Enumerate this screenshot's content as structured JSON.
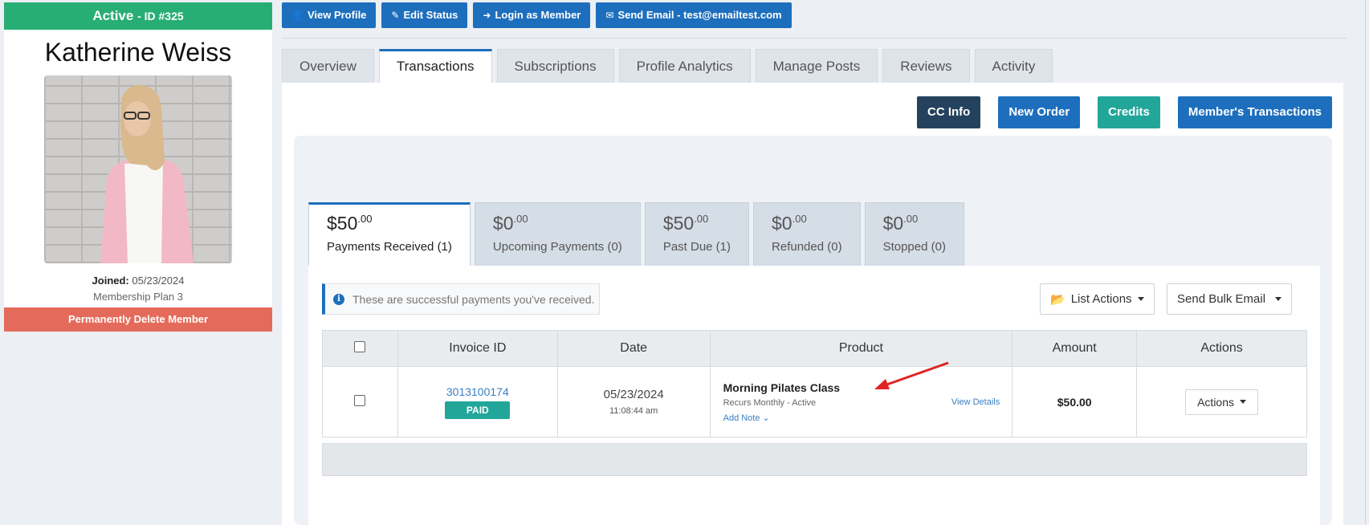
{
  "profile": {
    "status": "Active",
    "id_label": "- ID #325",
    "name": "Katherine Weiss",
    "joined_label": "Joined:",
    "joined_date": "05/23/2024",
    "plan": "Membership Plan 3",
    "delete_label": "Permanently Delete Member"
  },
  "top_buttons": {
    "view_profile": "View Profile",
    "edit_status": "Edit Status",
    "login_member": "Login as Member",
    "send_email": "Send Email - test@emailtest.com"
  },
  "tabs": [
    "Overview",
    "Transactions",
    "Subscriptions",
    "Profile Analytics",
    "Manage Posts",
    "Reviews",
    "Activity"
  ],
  "action_buttons": {
    "cc_info": "CC Info",
    "new_order": "New Order",
    "credits": "Credits",
    "members_transactions": "Member's Transactions"
  },
  "stats": [
    {
      "amount": "$50",
      "cents": ".00",
      "label": "Payments Received (1)"
    },
    {
      "amount": "$0",
      "cents": ".00",
      "label": "Upcoming Payments (0)"
    },
    {
      "amount": "$50",
      "cents": ".00",
      "label": "Past Due (1)"
    },
    {
      "amount": "$0",
      "cents": ".00",
      "label": "Refunded (0)"
    },
    {
      "amount": "$0",
      "cents": ".00",
      "label": "Stopped (0)"
    }
  ],
  "info_message": "These are successful payments you've received.",
  "list_actions": "List Actions",
  "send_bulk_email": "Send Bulk Email",
  "table": {
    "headers": {
      "invoice": "Invoice ID",
      "date": "Date",
      "product": "Product",
      "amount": "Amount",
      "actions": "Actions"
    },
    "rows": [
      {
        "invoice_id": "3013100174",
        "status": "PAID",
        "date": "05/23/2024",
        "time": "11:08:44 am",
        "product": "Morning Pilates Class",
        "recurrence": "Recurs Monthly - Active",
        "add_note": "Add Note",
        "view_details": "View Details",
        "amount": "$50.00",
        "actions_label": "Actions"
      }
    ]
  },
  "colors": {
    "brand_blue": "#1d6fbd",
    "active_green": "#27ae74",
    "danger": "#e46b5b",
    "teal": "#23a69a",
    "dark_navy": "#24425d",
    "arrow_red": "#e02424"
  }
}
